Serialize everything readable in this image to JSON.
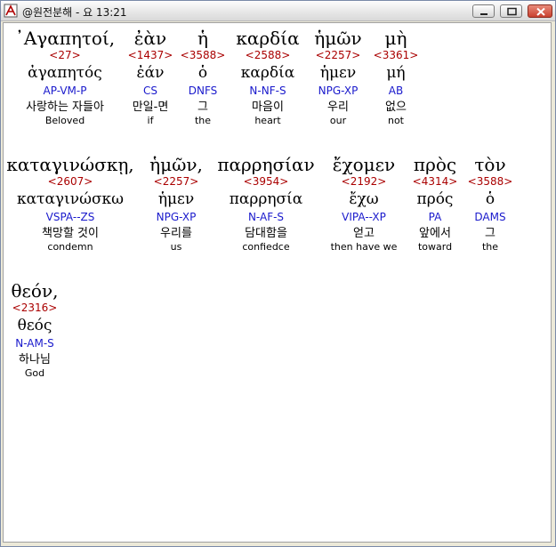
{
  "window": {
    "title": "@원전분해 - 요 13:21"
  },
  "words": [
    {
      "greek": "᾿Αγαπητοί,",
      "strong": "<27>",
      "lexeme": "ἀγαπητός",
      "parse": "AP-VM-P",
      "korean": "사랑하는 자들아",
      "english": "Beloved"
    },
    {
      "greek": "ἐὰν",
      "strong": "<1437>",
      "lexeme": "ἐάν",
      "parse": "CS",
      "korean": "만일-면",
      "english": "if"
    },
    {
      "greek": "ἡ",
      "strong": "<3588>",
      "lexeme": "ὁ",
      "parse": "DNFS",
      "korean": "그",
      "english": "the"
    },
    {
      "greek": "καρδία",
      "strong": "<2588>",
      "lexeme": "καρδία",
      "parse": "N-NF-S",
      "korean": "마음이",
      "english": "heart"
    },
    {
      "greek": "ἡμῶν",
      "strong": "<2257>",
      "lexeme": "ἡμεν",
      "parse": "NPG-XP",
      "korean": "우리",
      "english": "our"
    },
    {
      "greek": "μὴ",
      "strong": "<3361>",
      "lexeme": "μή",
      "parse": "AB",
      "korean": "없으",
      "english": "not"
    },
    {
      "greek": "καταγινώσκῃ,",
      "strong": "<2607>",
      "lexeme": "καταγινώσκω",
      "parse": "VSPA--ZS",
      "korean": "책망할 것이",
      "english": "condemn"
    },
    {
      "greek": "ἡμῶν,",
      "strong": "<2257>",
      "lexeme": "ἡμεν",
      "parse": "NPG-XP",
      "korean": "우리를",
      "english": "us"
    },
    {
      "greek": "παρρησίαν",
      "strong": "<3954>",
      "lexeme": "παρρησία",
      "parse": "N-AF-S",
      "korean": "담대함을",
      "english": "confiedce"
    },
    {
      "greek": "ἔχομεν",
      "strong": "<2192>",
      "lexeme": "ἔχω",
      "parse": "VIPA--XP",
      "korean": "얻고",
      "english": "then have we"
    },
    {
      "greek": "πρὸς",
      "strong": "<4314>",
      "lexeme": "πρός",
      "parse": "PA",
      "korean": "앞에서",
      "english": "toward"
    },
    {
      "greek": "τὸν",
      "strong": "<3588>",
      "lexeme": "ὁ",
      "parse": "DAMS",
      "korean": "그",
      "english": "the"
    },
    {
      "greek": "θεόν,",
      "strong": "<2316>",
      "lexeme": "θεός",
      "parse": "N-AM-S",
      "korean": "하나님",
      "english": "God"
    }
  ]
}
